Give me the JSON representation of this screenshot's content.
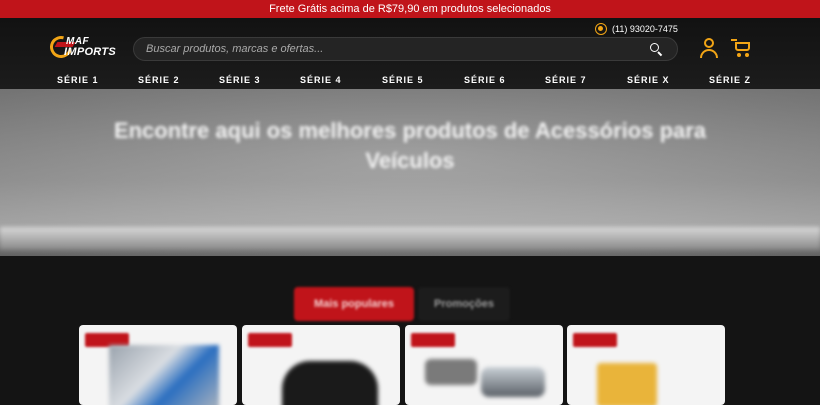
{
  "promo_bar": {
    "text": "Frete Grátis acima de R$79,90 em produtos selecionados"
  },
  "header": {
    "logo": {
      "line1": "MAF",
      "line2": "IMPORTS"
    },
    "phone": "(11) 93020-7475",
    "search": {
      "placeholder": "Buscar produtos, marcas e ofertas..."
    },
    "icons": [
      "whatsapp-icon",
      "search-icon",
      "user-icon",
      "cart-icon"
    ],
    "accent_color": "#f2a516"
  },
  "nav": {
    "items": [
      {
        "label": "SÉRIE 1"
      },
      {
        "label": "SÉRIE 2"
      },
      {
        "label": "SÉRIE 3"
      },
      {
        "label": "SÉRIE 4"
      },
      {
        "label": "SÉRIE 5"
      },
      {
        "label": "SÉRIE 6"
      },
      {
        "label": "SÉRIE 7"
      },
      {
        "label": "SÉRIE X"
      },
      {
        "label": "SÉRIE Z"
      }
    ]
  },
  "banner": {
    "eyebrow": "",
    "headline": "Encontre aqui os melhores produtos de Acessórios para Veículos"
  },
  "tabs": [
    {
      "label": "Mais populares",
      "active": true
    },
    {
      "label": "Promoções",
      "active": false
    }
  ],
  "products": [
    {
      "badge": ""
    },
    {
      "badge": ""
    },
    {
      "badge": ""
    },
    {
      "badge": ""
    }
  ],
  "colors": {
    "brand_red": "#c0141a",
    "header_bg": "#151515",
    "accent": "#f2a516"
  }
}
